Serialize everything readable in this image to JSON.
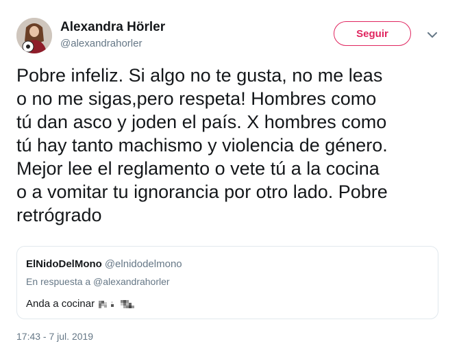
{
  "author": {
    "name": "Alexandra Hörler",
    "handle": "@alexandrahorler"
  },
  "actions": {
    "follow_label": "Seguir",
    "menu_icon": "chevron-down-icon"
  },
  "tweet": {
    "lines": [
      "Pobre infeliz. Si algo no te gusta, no me leas",
      "o no me sigas,pero respeta! Hombres como",
      "tú dan asco y joden el país. X hombres como",
      "tú hay tanto machismo y violencia de género.",
      "Mejor lee el reglamento o vete tú a la cocina",
      "o a vomitar tu ignorancia por otro lado. Pobre",
      "retrógrado"
    ],
    "timestamp": "17:43 - 7 jul. 2019"
  },
  "quoted_tweet": {
    "name": "ElNidoDelMono",
    "handle": "@elnidodelmono",
    "reply_to": "En respuesta a @alexandrahorler",
    "text": "Anda a cocinar",
    "censored_icon": "pixelated-emoji-icon"
  },
  "colors": {
    "accent": "#e0245e",
    "text_primary": "#14171a",
    "text_secondary": "#657786",
    "border": "#e1e8ed"
  }
}
